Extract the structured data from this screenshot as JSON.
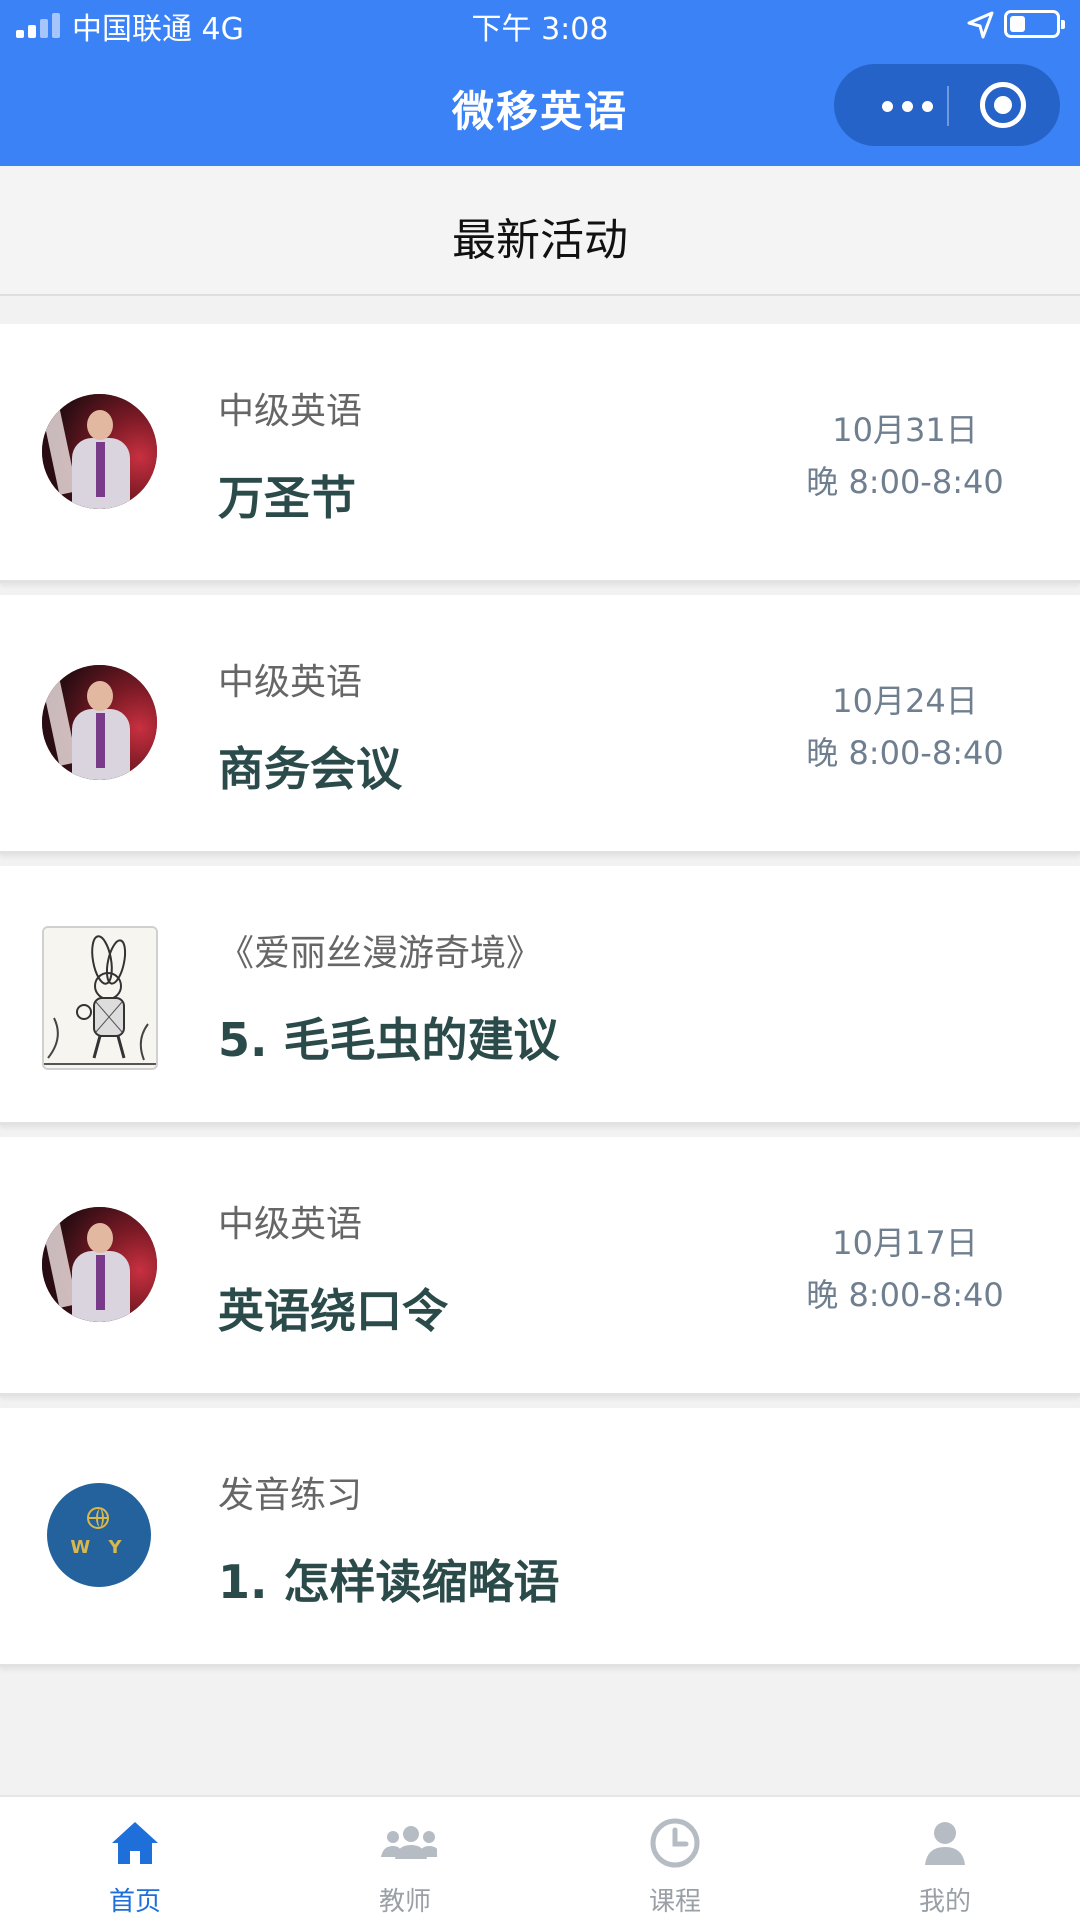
{
  "status_bar": {
    "carrier": "中国联通 4G",
    "time": "下午 3:08"
  },
  "nav": {
    "title": "微移英语"
  },
  "section": {
    "title": "最新活动"
  },
  "activities": [
    {
      "subtitle": "中级英语",
      "title": "万圣节",
      "date": "10月31日",
      "time": "晚 8:00-8:40",
      "image": "teacher-avatar"
    },
    {
      "subtitle": "中级英语",
      "title": "商务会议",
      "date": "10月24日",
      "time": "晚 8:00-8:40",
      "image": "teacher-avatar"
    },
    {
      "subtitle": "《爱丽丝漫游奇境》",
      "title": "5. 毛毛虫的建议",
      "date": "",
      "time": "",
      "image": "white-rabbit-illustration"
    },
    {
      "subtitle": "中级英语",
      "title": "英语绕口令",
      "date": "10月17日",
      "time": "晚 8:00-8:40",
      "image": "teacher-avatar"
    },
    {
      "subtitle": "发音练习",
      "title": "1. 怎样读缩略语",
      "date": "",
      "time": "",
      "image": "wy-logo",
      "logo_text": "W Y"
    }
  ],
  "tabbar": {
    "tabs": [
      {
        "label": "首页",
        "icon": "home-icon",
        "active": true
      },
      {
        "label": "教师",
        "icon": "teachers-icon",
        "active": false
      },
      {
        "label": "课程",
        "icon": "clock-icon",
        "active": false
      },
      {
        "label": "我的",
        "icon": "user-icon",
        "active": false
      }
    ]
  },
  "colors": {
    "nav_bg": "#3b82f6",
    "tab_active": "#1e6fd9",
    "tab_inactive": "#9aa0a6",
    "title_text": "#2b4a4a"
  }
}
